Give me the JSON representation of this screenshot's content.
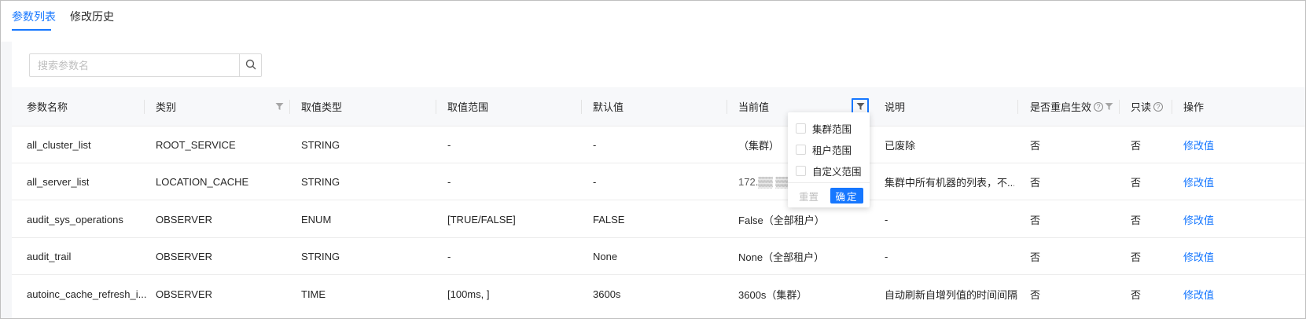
{
  "tabs": [
    {
      "label": "参数列表",
      "active": true
    },
    {
      "label": "修改历史",
      "active": false
    }
  ],
  "search": {
    "placeholder": "搜索参数名",
    "icon": "search-icon"
  },
  "table": {
    "columns": [
      "参数名称",
      "类别",
      "取值类型",
      "取值范围",
      "默认值",
      "当前值",
      "说明",
      "是否重启生效",
      "只读",
      "操作"
    ],
    "rows": [
      {
        "name": "all_cluster_list",
        "category": "ROOT_SERVICE",
        "type": "STRING",
        "range": "-",
        "default": "-",
        "current": "（集群）",
        "desc": "已废除",
        "restart": "否",
        "readonly": "否",
        "action": "修改值"
      },
      {
        "name": "all_server_list",
        "category": "LOCATION_CACHE",
        "type": "STRING",
        "range": "-",
        "default": "-",
        "current": "172.▒▒ ▒▒ 1",
        "desc": "集群中所有机器的列表，不...",
        "restart": "否",
        "readonly": "否",
        "action": "修改值"
      },
      {
        "name": "audit_sys_operations",
        "category": "OBSERVER",
        "type": "ENUM",
        "range": "[TRUE/FALSE]",
        "default": "FALSE",
        "current": "False（全部租户）",
        "desc": "-",
        "restart": "否",
        "readonly": "否",
        "action": "修改值"
      },
      {
        "name": "audit_trail",
        "category": "OBSERVER",
        "type": "STRING",
        "range": "-",
        "default": "None",
        "current": "None（全部租户）",
        "desc": "-",
        "restart": "否",
        "readonly": "否",
        "action": "修改值"
      },
      {
        "name": "autoinc_cache_refresh_i...",
        "category": "OBSERVER",
        "type": "TIME",
        "range": "[100ms, ]",
        "default": "3600s",
        "current": "3600s（集群）",
        "desc": "自动刷新自增列值的时间间隔",
        "restart": "否",
        "readonly": "否",
        "action": "修改值"
      }
    ]
  },
  "filter_dropdown": {
    "options": [
      "集群范围",
      "租户范围",
      "自定义范围"
    ],
    "reset_label": "重置",
    "ok_label": "确定"
  },
  "colors": {
    "accent": "#1677ff",
    "header_bg": "#f7f8fa"
  }
}
